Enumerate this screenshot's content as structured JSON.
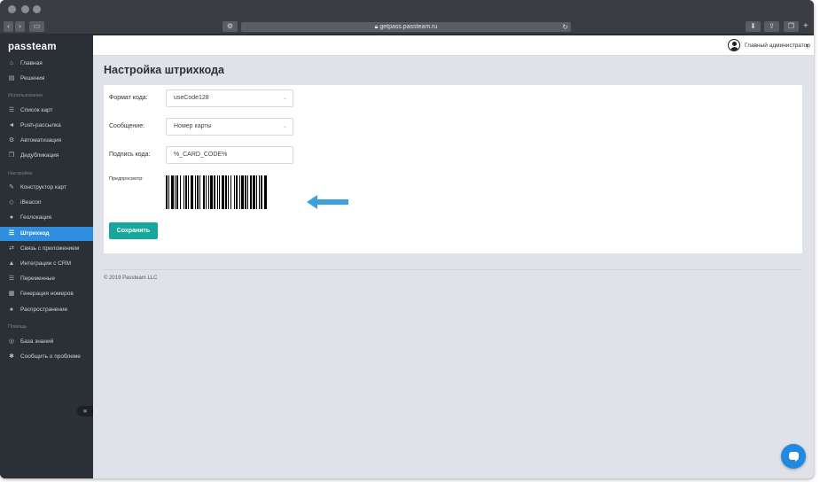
{
  "browser": {
    "url": "getpass.passteam.ru",
    "icons": [
      "back-icon",
      "forward-icon",
      "sidebar-icon",
      "settings-icon",
      "lock-icon",
      "reload-icon",
      "download-icon",
      "share-icon",
      "tabs-icon",
      "plus-icon"
    ]
  },
  "sidebar": {
    "logo": "passteam",
    "items": [
      {
        "label": "Главная",
        "icon": "home-icon",
        "glyph": "⌂"
      },
      {
        "label": "Решения",
        "icon": "grid-icon",
        "glyph": "▤"
      },
      {
        "section": "Использование"
      },
      {
        "label": "Список карт",
        "icon": "list-icon",
        "glyph": "☰"
      },
      {
        "label": "Push-рассылка",
        "icon": "megaphone-icon",
        "glyph": "◄"
      },
      {
        "label": "Автоматизация",
        "icon": "gear-icon",
        "glyph": "⚙"
      },
      {
        "label": "Дедубликация",
        "icon": "copy-icon",
        "glyph": "❐"
      },
      {
        "section": "Настройка"
      },
      {
        "label": "Конструктор карт",
        "icon": "brush-icon",
        "glyph": "✎"
      },
      {
        "label": "iBeacon",
        "icon": "tag-icon",
        "glyph": "◇"
      },
      {
        "label": "Геолокация",
        "icon": "location-pin-icon",
        "glyph": "●"
      },
      {
        "label": "Штрихкод",
        "icon": "barcode-icon",
        "glyph": "☰",
        "active": true
      },
      {
        "label": "Связь с приложением",
        "icon": "link-icon",
        "glyph": "⇄"
      },
      {
        "label": "Интеграции с CRM",
        "icon": "sitemap-icon",
        "glyph": "▲"
      },
      {
        "label": "Переменные",
        "icon": "variables-icon",
        "glyph": "☰"
      },
      {
        "label": "Генерация номеров",
        "icon": "table-icon",
        "glyph": "▦"
      },
      {
        "label": "Распространение",
        "icon": "bell-icon",
        "glyph": "♠"
      },
      {
        "section": "Помощь"
      },
      {
        "label": "База знаний",
        "icon": "lifebuoy-icon",
        "glyph": "◎"
      },
      {
        "label": "Сообщить о проблеме",
        "icon": "bug-icon",
        "glyph": "✱"
      }
    ],
    "collapse_icon": "collapse-icon",
    "collapse_glyph": "«"
  },
  "header": {
    "user_label": "Главный администратор",
    "avatar_icon": "user-avatar-icon",
    "caret_icon": "caret-down-icon"
  },
  "main": {
    "title": "Настройка штрихкода",
    "form": {
      "format_label": "Формат кода:",
      "format_value": "useCode128",
      "message_label": "Сообщение:",
      "message_value": "Номер карты",
      "caption_label": "Подпись кода:",
      "caption_value": "%_CARD_CODE%",
      "preview_label": "Предпросмотр:",
      "save_label": "Сохранить"
    },
    "arrow_color": "#3aa0e0",
    "footer": "© 2019 Passteam LLC"
  },
  "colors": {
    "sidebar_bg": "#2b2f36",
    "accent": "#2f8ee0",
    "save_button": "#17a79d",
    "main_bg": "#dfe3e9",
    "chat": "#2189e0"
  },
  "chat_icon": "chat-bubble-icon"
}
